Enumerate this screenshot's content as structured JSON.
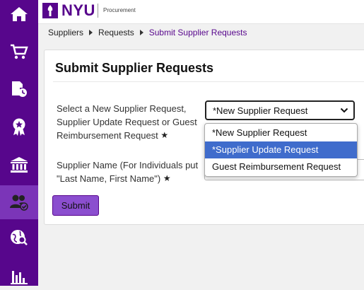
{
  "header": {
    "brand": "NYU",
    "subtitle": "Procurement"
  },
  "breadcrumb": {
    "items": [
      "Suppliers",
      "Requests"
    ],
    "current": "Submit Supplier Requests"
  },
  "page": {
    "title": "Submit Supplier Requests"
  },
  "form": {
    "request_type_label": "Select a New Supplier Request, Supplier Update Request or Guest Reimbursement Request",
    "request_type_value": "*New Supplier Request",
    "supplier_name_label": "Supplier Name (For Individuals put \"Last Name, First Name\")",
    "required_marker": "★",
    "submit_label": "Submit"
  },
  "dropdown": {
    "options": [
      "*New Supplier Request",
      "*Supplier Update Request",
      "Guest Reimbursement Request"
    ],
    "highlighted": "*Supplier Update Request"
  },
  "sidebar": {
    "items": [
      {
        "icon": "home-icon"
      },
      {
        "icon": "cart-icon"
      },
      {
        "icon": "document-clock-icon"
      },
      {
        "icon": "award-ribbon-icon"
      },
      {
        "icon": "bank-icon"
      },
      {
        "icon": "users-check-icon",
        "active": true
      },
      {
        "icon": "globe-search-icon"
      },
      {
        "icon": "bar-chart-icon"
      }
    ]
  },
  "colors": {
    "brand_purple": "#57068c",
    "active_nav": "#7b35b8",
    "submit_button": "#8b4ecf",
    "highlight_blue": "#3f6ccc"
  }
}
